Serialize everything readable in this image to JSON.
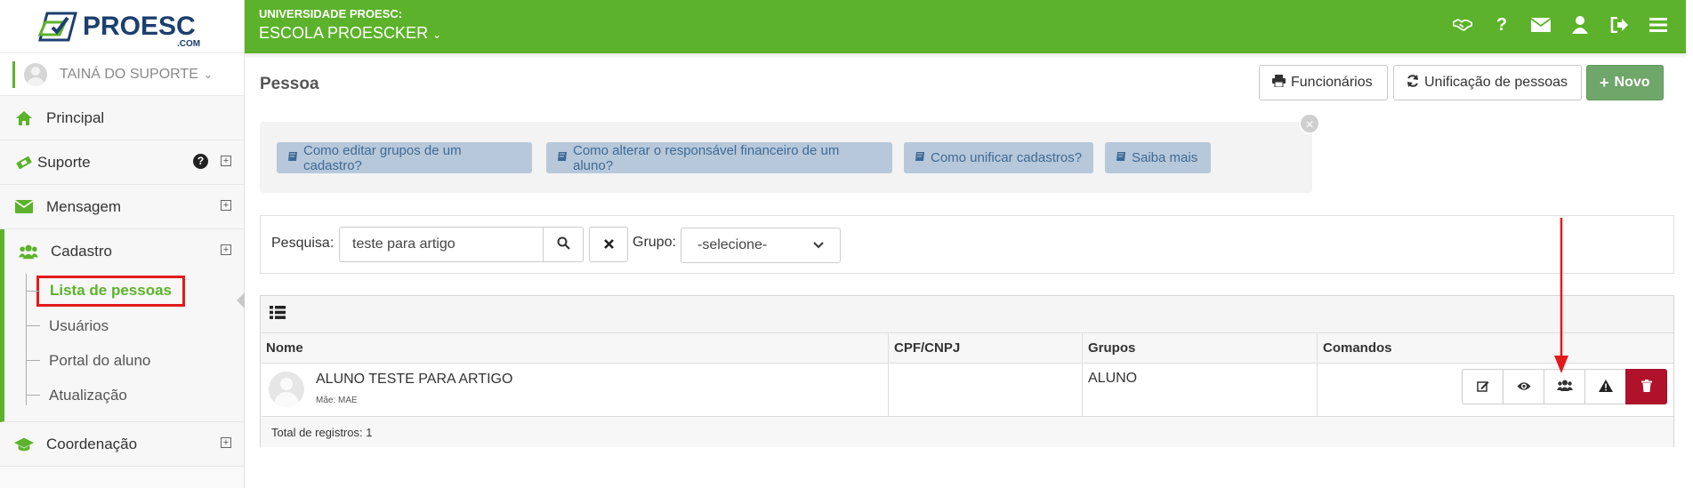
{
  "brand": {
    "logo_text": "PROESC",
    "logo_sub": ".COM",
    "accent": "#5cb22a",
    "annotation_color": "#e31a1a"
  },
  "header": {
    "org": "UNIVERSIDADE PROESC:",
    "school": "ESCOLA PROESCKER",
    "icons": [
      "handshake-icon",
      "question-icon",
      "envelope-icon",
      "user-icon",
      "sign-out-icon",
      "menu-icon"
    ]
  },
  "sidebar": {
    "user": "TAINÁ DO SUPORTE",
    "items": [
      {
        "label": "Principal",
        "icon": "home-icon"
      },
      {
        "label": "Suporte",
        "icon": "ticket-icon"
      },
      {
        "label": "Mensagem",
        "icon": "envelope-icon"
      },
      {
        "label": "Cadastro",
        "icon": "users-icon"
      },
      {
        "label": "Coordenação",
        "icon": "graduation-cap-icon"
      }
    ],
    "cadastro_sub": [
      "Lista de pessoas",
      "Usuários",
      "Portal do aluno",
      "Atualização"
    ]
  },
  "page": {
    "title": "Pessoa",
    "buttons": {
      "funcionarios": "Funcionários",
      "unificacao": "Unificação de pessoas",
      "novo": "Novo"
    }
  },
  "help_links": [
    "Como editar grupos de um cadastro?",
    "Como alterar o responsável financeiro de um aluno?",
    "Como unificar cadastros?",
    "Saiba mais"
  ],
  "help_close": "×",
  "search": {
    "label": "Pesquisa:",
    "value": "teste para artigo",
    "group_label": "Grupo:",
    "group_selected": "-selecione-"
  },
  "table": {
    "columns": [
      "Nome",
      "CPF/CNPJ",
      "Grupos",
      "Comandos"
    ],
    "rows": [
      {
        "name": "ALUNO TESTE PARA ARTIGO",
        "sub": "Mãe: MAE",
        "cpf": "",
        "groups": "ALUNO"
      }
    ],
    "commands": [
      "edit-icon",
      "eye-icon",
      "users-icon",
      "warning-icon",
      "trash-icon"
    ],
    "footer": "Total de registros: 1"
  }
}
